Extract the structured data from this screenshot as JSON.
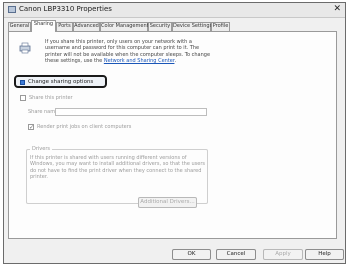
{
  "window": {
    "title": "Canon LBP3310 Properties",
    "close_glyph": "✕"
  },
  "tabs": [
    {
      "label": "General"
    },
    {
      "label": "Sharing"
    },
    {
      "label": "Ports"
    },
    {
      "label": "Advanced"
    },
    {
      "label": "Color Management"
    },
    {
      "label": "Security"
    },
    {
      "label": "Device Settings"
    },
    {
      "label": "Profile"
    }
  ],
  "active_tab": "Sharing",
  "sharing": {
    "info_text": "If you share this printer, only users on your network with a\nusername and password for this computer can print to it. The\nprinter will not be available when the computer sleeps. To change\nthese settings, use the ",
    "info_link": "Network and Sharing Center",
    "info_end": ".",
    "change_button": "Change sharing options",
    "share_checkbox": {
      "label": "Share this printer",
      "checked": false
    },
    "share_name": {
      "label": "Share name:",
      "value": ""
    },
    "render_checkbox": {
      "label": "Render print jobs on client computers",
      "checked": true,
      "mark": "✓"
    },
    "drivers": {
      "title": "Drivers",
      "text": "If this printer is shared with users running different versions of Windows, you may want to install additional drivers, so that the users do not have to find the print driver when they connect to the shared printer.",
      "button": "Additional Drivers..."
    }
  },
  "footer": {
    "ok": "OK",
    "cancel": "Cancel",
    "apply": "Apply",
    "help": "Help"
  },
  "colors": {
    "link": "#1a56b8",
    "disabled_text": "#9a9a9a",
    "focus_border": "#1a1a1a"
  }
}
